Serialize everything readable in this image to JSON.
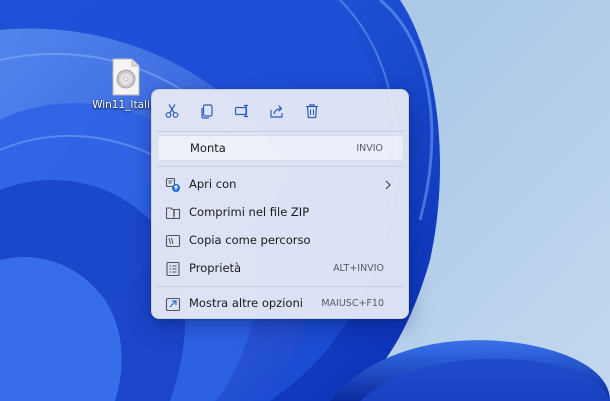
{
  "desktop": {
    "file_icon": "disc-image-icon",
    "file_label": "Win11_Itali..."
  },
  "context_menu": {
    "toolbar": [
      {
        "icon": "cut-icon"
      },
      {
        "icon": "copy-icon"
      },
      {
        "icon": "rename-icon"
      },
      {
        "icon": "share-icon"
      },
      {
        "icon": "delete-icon"
      }
    ],
    "items": [
      {
        "label": "Monta",
        "shortcut": "INVIO",
        "icon": ""
      },
      {
        "label": "Apri con",
        "shortcut": "",
        "icon": "open-with-icon",
        "submenu": true
      },
      {
        "label": "Comprimi nel file ZIP",
        "shortcut": "",
        "icon": "zip-folder-icon"
      },
      {
        "label": "Copia come percorso",
        "shortcut": "",
        "icon": "copy-path-icon"
      },
      {
        "label": "Proprietà",
        "shortcut": "ALT+INVIO",
        "icon": "properties-icon"
      },
      {
        "label": "Mostra altre opzioni",
        "shortcut": "MAIUSC+F10",
        "icon": "more-options-icon"
      }
    ]
  },
  "colors": {
    "wallpaper_blue": "#1f56d8",
    "menu_background": "#e4e8f6",
    "icon_accent": "#2b5fb5"
  }
}
